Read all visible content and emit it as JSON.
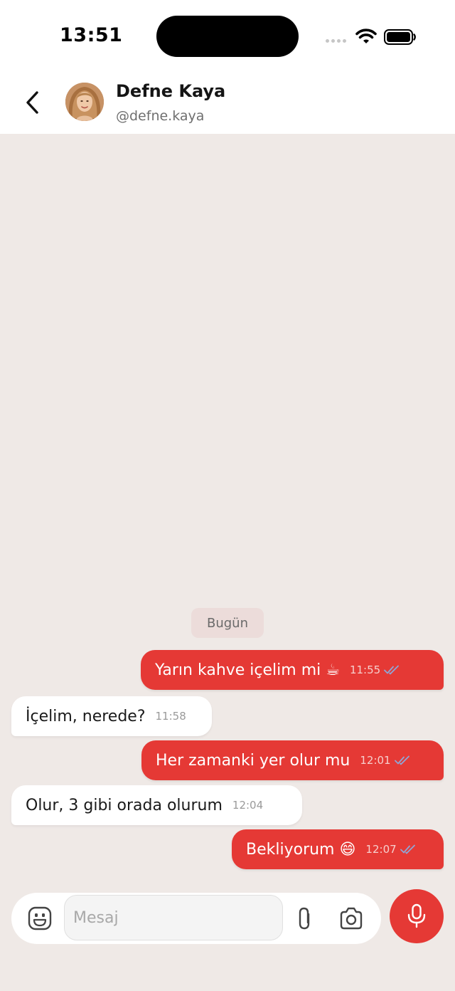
{
  "status_bar": {
    "time": "13:51"
  },
  "header": {
    "contact_name": "Defne Kaya",
    "contact_handle": "@defne.kaya",
    "back_icon": "chevron-left-icon",
    "avatar": "contact-avatar-photo"
  },
  "chat": {
    "date_label": "Bugün",
    "messages": [
      {
        "direction": "out",
        "text": "Yarın kahve içelim mi ☕",
        "time": "11:55",
        "status": "read"
      },
      {
        "direction": "in",
        "text": "İçelim, nerede?",
        "time": "11:58"
      },
      {
        "direction": "out",
        "text": "Her zamanki yer olur mu",
        "time": "12:01",
        "status": "read"
      },
      {
        "direction": "in",
        "text": "Olur, 3 gibi orada olurum",
        "time": "12:04"
      },
      {
        "direction": "out",
        "text": "Bekliyorum 😄",
        "time": "12:07",
        "status": "read"
      }
    ]
  },
  "composer": {
    "placeholder": "Mesaj",
    "value": "",
    "icons": [
      "emoji-icon",
      "paperclip-icon",
      "camera-icon",
      "microphone-icon"
    ]
  },
  "colors": {
    "accent": "#e53935",
    "background": "#efe9e6",
    "incoming_bubble": "#ffffff",
    "date_chip": "#ecdcda"
  }
}
